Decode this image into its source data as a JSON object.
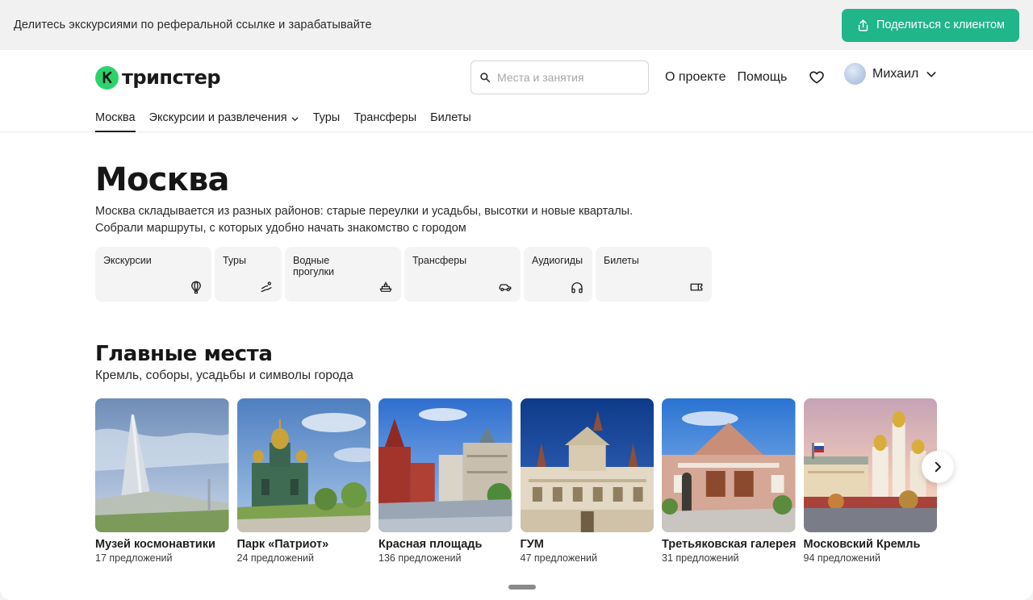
{
  "banner": {
    "text": "Делитесь экскурсиями по реферальной ссылке и зарабатывайте",
    "share_label": "Поделиться с клиентом",
    "accent": "#21b58a"
  },
  "header": {
    "logo_text": "трипстер",
    "logo_color": "#2dd36a",
    "search_placeholder": "Места и занятия",
    "links": [
      "О проекте",
      "Помощь"
    ],
    "user_name": "Михаил"
  },
  "nav": {
    "items": [
      {
        "label": "Москва",
        "active": true
      },
      {
        "label": "Экскурсии и развлечения",
        "dropdown": true
      },
      {
        "label": "Туры"
      },
      {
        "label": "Трансферы"
      },
      {
        "label": "Билеты"
      }
    ]
  },
  "hero": {
    "title": "Москва",
    "desc_line1": "Москва складывается из разных районов: старые переулки и усадьбы, высотки и новые кварталы.",
    "desc_line2": "Собрали маршруты, с которых удобно начать знакомство с городом"
  },
  "categories": [
    {
      "line1": "Экскурсии",
      "line2": "",
      "icon": "hot-air-balloon-icon"
    },
    {
      "line1": "Туры",
      "line2": "",
      "icon": "route-icon"
    },
    {
      "line1": "Водные",
      "line2": "прогулки",
      "icon": "boat-icon"
    },
    {
      "line1": "Трансферы",
      "line2": "",
      "icon": "car-icon"
    },
    {
      "line1": "Аудиогиды",
      "line2": "",
      "icon": "headphones-icon"
    },
    {
      "line1": "Билеты",
      "line2": "",
      "icon": "ticket-icon"
    }
  ],
  "places": {
    "title": "Главные места",
    "subtitle": "Кремль, соборы, усадьбы и символы города",
    "items": [
      {
        "name": "Музей космонавтики",
        "count": "17 предложений"
      },
      {
        "name": "Парк «Патриот»",
        "count": "24 предложений"
      },
      {
        "name": "Красная площадь",
        "count": "136 предложений"
      },
      {
        "name": "ГУМ",
        "count": "47 предложений"
      },
      {
        "name": "Третьяковская галерея",
        "count": "31 предложений"
      },
      {
        "name": "Московский Кремль",
        "count": "94 предложений"
      }
    ]
  }
}
